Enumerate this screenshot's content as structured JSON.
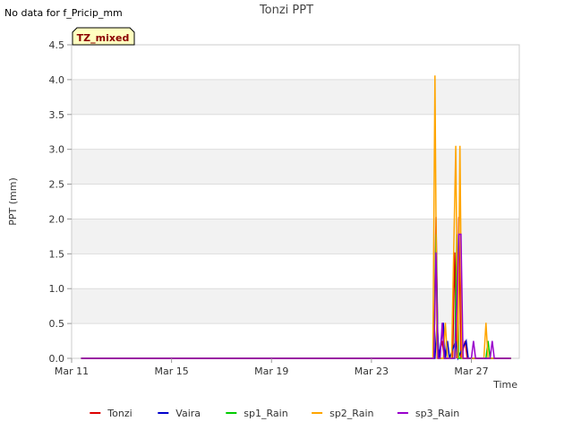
{
  "note": "No data for f_Pricip_mm",
  "badge": "TZ_mixed",
  "chart_data": {
    "type": "line",
    "title": "Tonzi PPT",
    "xlabel": "Time",
    "ylabel": "PPT (mm)",
    "x_ticks": [
      "Mar 11",
      "Mar 15",
      "Mar 19",
      "Mar 23",
      "Mar 27"
    ],
    "y_ticks": [
      "0.0",
      "0.5",
      "1.0",
      "1.5",
      "2.0",
      "2.5",
      "3.0",
      "3.5",
      "4.0",
      "4.5"
    ],
    "xlim": [
      "2024-03-11",
      "2024-03-28T22:00"
    ],
    "ylim": [
      0,
      4.5
    ],
    "grid": true,
    "legend_position": "bottom",
    "series": [
      {
        "name": "Tonzi",
        "color": "#dd0000",
        "points": [
          [
            "2024-03-11T09:00",
            0
          ],
          [
            "2024-03-25T12:00",
            0
          ],
          [
            "2024-03-25T14:00",
            2.03
          ],
          [
            "2024-03-25T16:00",
            0
          ],
          [
            "2024-03-25T20:00",
            0.25
          ],
          [
            "2024-03-25T22:00",
            0
          ],
          [
            "2024-03-26T06:00",
            0
          ],
          [
            "2024-03-26T08:00",
            1.52
          ],
          [
            "2024-03-26T10:00",
            0
          ],
          [
            "2024-03-26T12:00",
            2.03
          ],
          [
            "2024-03-26T14:00",
            0
          ],
          [
            "2024-03-26T18:00",
            0.25
          ],
          [
            "2024-03-26T20:00",
            0
          ],
          [
            "2024-03-28T14:00",
            0
          ]
        ]
      },
      {
        "name": "Vaira",
        "color": "#0000cc",
        "points": [
          [
            "2024-03-11T09:00",
            0
          ],
          [
            "2024-03-25T13:00",
            0
          ],
          [
            "2024-03-25T15:00",
            0.51
          ],
          [
            "2024-03-25T17:00",
            0
          ],
          [
            "2024-03-25T21:00",
            0.51
          ],
          [
            "2024-03-25T23:00",
            0
          ],
          [
            "2024-03-26T01:00",
            0.25
          ],
          [
            "2024-03-26T03:00",
            0
          ],
          [
            "2024-03-26T09:00",
            0.25
          ],
          [
            "2024-03-26T11:00",
            0
          ],
          [
            "2024-03-26T19:00",
            0.25
          ],
          [
            "2024-03-26T21:00",
            0
          ],
          [
            "2024-03-28T14:00",
            0
          ]
        ]
      },
      {
        "name": "sp1_Rain",
        "color": "#00cc00",
        "points": [
          [
            "2024-03-11T09:00",
            0
          ],
          [
            "2024-03-25T12:00",
            0
          ],
          [
            "2024-03-25T14:00",
            1.78
          ],
          [
            "2024-03-25T16:00",
            0
          ],
          [
            "2024-03-26T08:00",
            0
          ],
          [
            "2024-03-26T10:00",
            1.78
          ],
          [
            "2024-03-26T12:00",
            0
          ],
          [
            "2024-03-27T14:00",
            0
          ],
          [
            "2024-03-27T16:00",
            0.25
          ],
          [
            "2024-03-27T18:00",
            0
          ],
          [
            "2024-03-28T14:00",
            0
          ]
        ]
      },
      {
        "name": "sp2_Rain",
        "color": "#ffa500",
        "points": [
          [
            "2024-03-11T09:00",
            0
          ],
          [
            "2024-03-25T11:00",
            0
          ],
          [
            "2024-03-25T13:00",
            4.06
          ],
          [
            "2024-03-25T15:00",
            0
          ],
          [
            "2024-03-25T21:00",
            0
          ],
          [
            "2024-03-25T23:00",
            0.51
          ],
          [
            "2024-03-26T01:00",
            0
          ],
          [
            "2024-03-26T05:00",
            0
          ],
          [
            "2024-03-26T07:00",
            1.52
          ],
          [
            "2024-03-26T09:00",
            3.05
          ],
          [
            "2024-03-26T11:00",
            0
          ],
          [
            "2024-03-26T13:00",
            3.05
          ],
          [
            "2024-03-26T15:00",
            0
          ],
          [
            "2024-03-27T12:00",
            0
          ],
          [
            "2024-03-27T14:00",
            0.51
          ],
          [
            "2024-03-27T16:00",
            0
          ],
          [
            "2024-03-28T14:00",
            0
          ]
        ]
      },
      {
        "name": "sp3_Rain",
        "color": "#9900cc",
        "points": [
          [
            "2024-03-11T09:00",
            0
          ],
          [
            "2024-03-25T12:00",
            0
          ],
          [
            "2024-03-25T14:00",
            1.52
          ],
          [
            "2024-03-25T16:00",
            0
          ],
          [
            "2024-03-25T18:00",
            0
          ],
          [
            "2024-03-25T20:00",
            0.51
          ],
          [
            "2024-03-25T22:00",
            0
          ],
          [
            "2024-03-26T08:00",
            0
          ],
          [
            "2024-03-26T10:00",
            0.76
          ],
          [
            "2024-03-26T12:00",
            1.78
          ],
          [
            "2024-03-26T14:00",
            1.78
          ],
          [
            "2024-03-26T16:00",
            0
          ],
          [
            "2024-03-27T00:00",
            0
          ],
          [
            "2024-03-27T02:00",
            0.25
          ],
          [
            "2024-03-27T04:00",
            0
          ],
          [
            "2024-03-27T18:00",
            0
          ],
          [
            "2024-03-27T20:00",
            0.25
          ],
          [
            "2024-03-27T22:00",
            0
          ],
          [
            "2024-03-28T14:00",
            0
          ]
        ]
      }
    ]
  }
}
